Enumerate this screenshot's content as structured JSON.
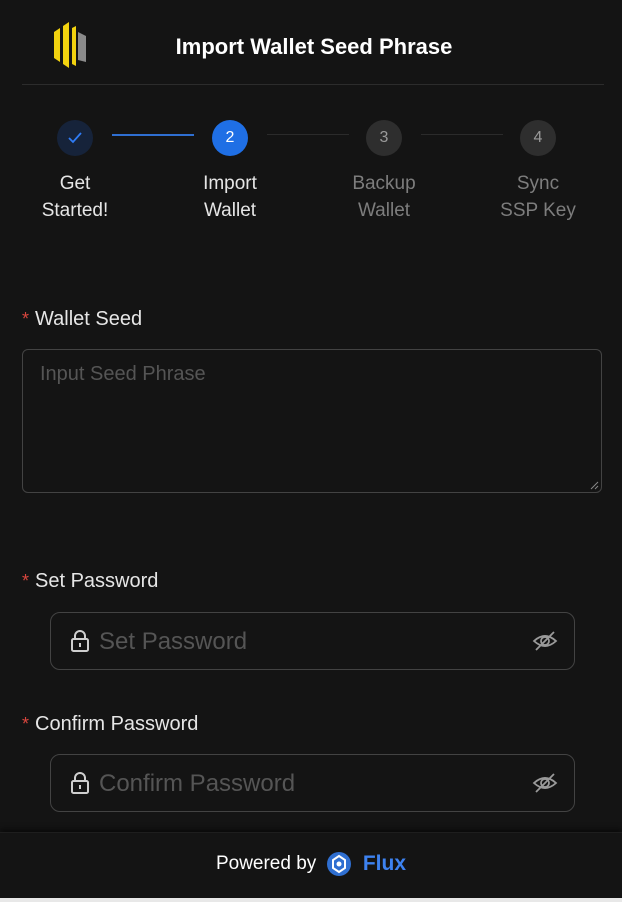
{
  "header": {
    "title": "Import Wallet Seed Phrase"
  },
  "steps": [
    {
      "number": "",
      "label_line1": "Get",
      "label_line2": "Started!",
      "status": "done"
    },
    {
      "number": "2",
      "label_line1": "Import",
      "label_line2": "Wallet",
      "status": "active"
    },
    {
      "number": "3",
      "label_line1": "Backup",
      "label_line2": "Wallet",
      "status": "todo"
    },
    {
      "number": "4",
      "label_line1": "Sync",
      "label_line2": "SSP Key",
      "status": "todo"
    }
  ],
  "form": {
    "seed": {
      "label": "Wallet Seed",
      "required_mark": "*",
      "placeholder": "Input Seed Phrase",
      "value": ""
    },
    "password": {
      "label": "Set Password",
      "required_mark": "*",
      "placeholder": "Set Password",
      "value": ""
    },
    "confirm": {
      "label": "Confirm Password",
      "required_mark": "*",
      "placeholder": "Confirm Password",
      "value": ""
    }
  },
  "footer": {
    "powered_text": "Powered by",
    "brand": "Flux"
  },
  "icons": {
    "logo": "ssp-logo",
    "step_done": "check-icon",
    "lock": "lock-icon",
    "visibility": "eye-invisible-icon",
    "flux": "flux-logo-icon"
  },
  "colors": {
    "accent": "#1f6fe5",
    "required": "#d9463e",
    "logo_yellow": "#f2d20f",
    "logo_gray": "#8a8a8a"
  }
}
